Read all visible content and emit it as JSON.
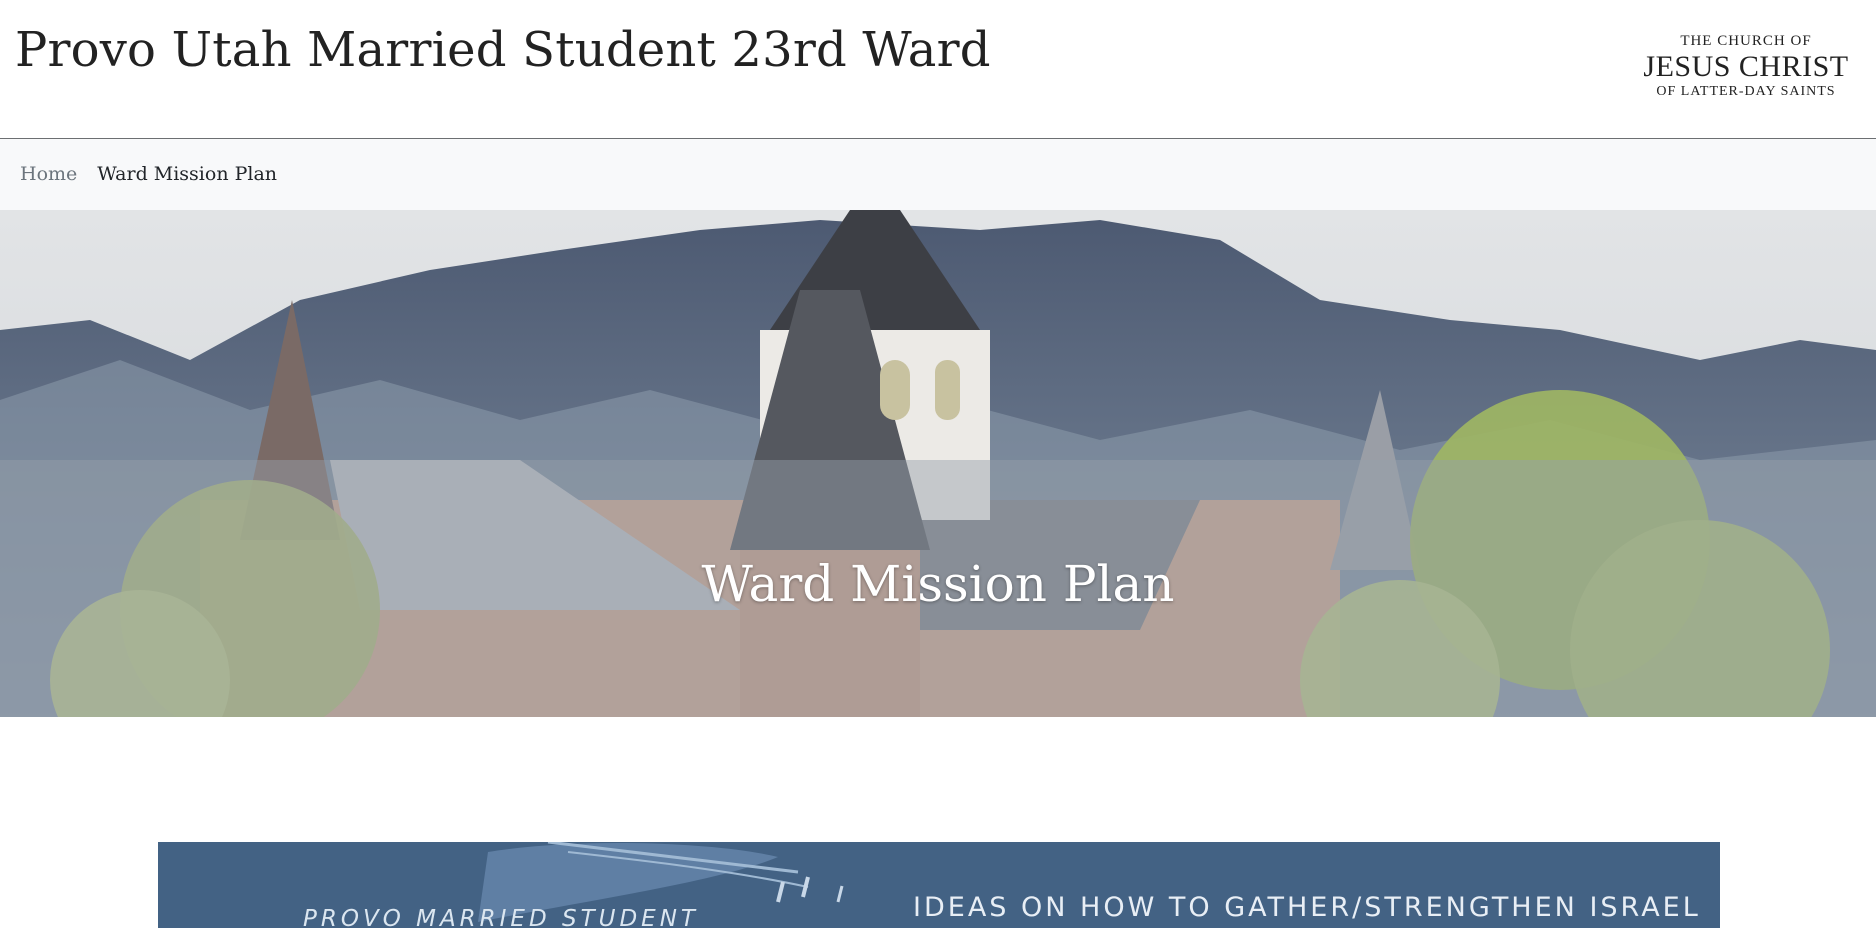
{
  "header": {
    "title": "Provo Utah Married Student 23rd Ward",
    "logo": {
      "line1": "THE CHURCH OF",
      "line2": "JESUS CHRIST",
      "line3": "OF LATTER-DAY SAINTS"
    }
  },
  "breadcrumb": {
    "home": "Home",
    "current": "Ward Mission Plan"
  },
  "hero": {
    "title": "Ward Mission Plan"
  },
  "banner": {
    "left_text": "PROVO MARRIED STUDENT",
    "right_text": "IDEAS ON HOW TO GATHER/STRENGTHEN ISRAEL"
  },
  "colors": {
    "banner_bg": "#436284",
    "breadcrumb_bg": "#f8f9fa"
  }
}
